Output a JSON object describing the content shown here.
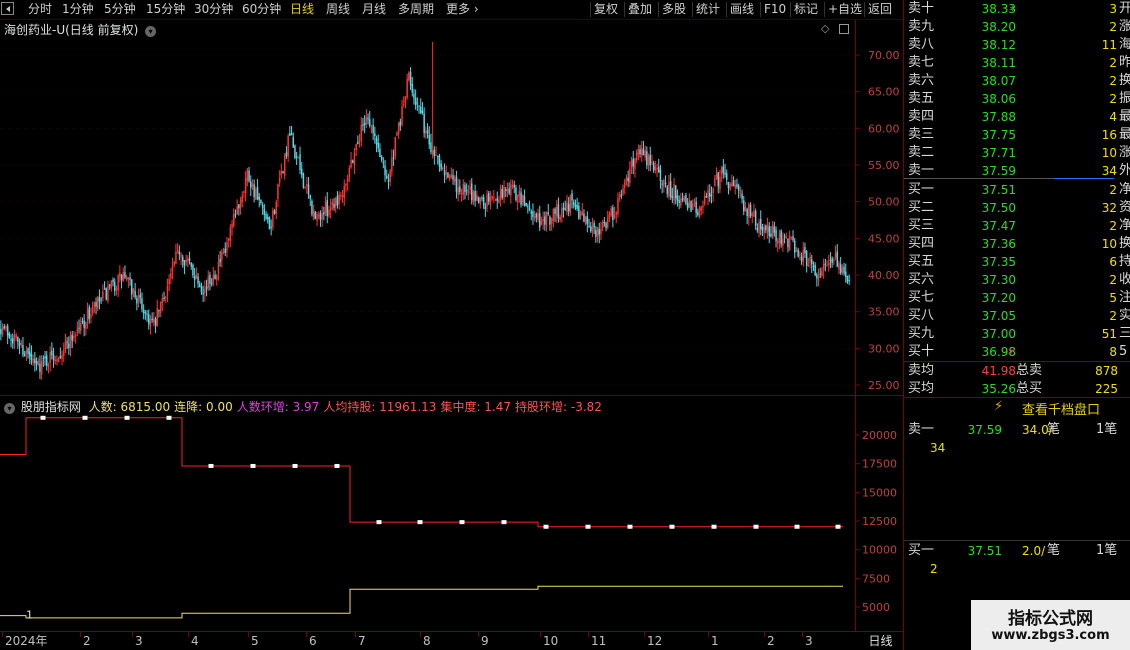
{
  "toolbar": {
    "periods": [
      "分时",
      "1分钟",
      "5分钟",
      "15分钟",
      "30分钟",
      "60分钟",
      "日线",
      "周线",
      "月线",
      "多周期",
      "更多"
    ],
    "active_period": "日线",
    "actions": [
      "复权",
      "叠加",
      "多股",
      "统计",
      "画线",
      "F10",
      "标记",
      "+自选",
      "返回"
    ]
  },
  "colors": {
    "up": "#ff3232",
    "down": "#54d8e6",
    "line_red": "#ff2020",
    "line_yellow": "#f0e060",
    "grid": "#7a0000",
    "axis_text": "#c04040"
  },
  "main_chart": {
    "title": "海创药业-U(日线 前复权)",
    "price_axis": [
      "70.00",
      "65.00",
      "60.00",
      "55.00",
      "50.00",
      "45.00",
      "40.00",
      "35.00",
      "30.00",
      "25.00"
    ],
    "axis_range": [
      25,
      70
    ]
  },
  "indicator": {
    "name": "股朋指标网",
    "values": [
      {
        "label": "人数: 6815.00",
        "color": "#f0e060"
      },
      {
        "label": "连降: 0.00",
        "color": "#f0e060"
      },
      {
        "label": "人数环增: 3.97",
        "color": "#e040e0"
      },
      {
        "label": "人均持股: 11961.13",
        "color": "#ff5050"
      },
      {
        "label": "集中度: 1.47",
        "color": "#ff5050"
      },
      {
        "label": "持股环增: -3.82",
        "color": "#ff5050"
      }
    ],
    "axis": [
      "20000",
      "17500",
      "15000",
      "12500",
      "10000",
      "7500",
      "5000"
    ],
    "axis_range": [
      5000,
      20000
    ],
    "marker_label": "1"
  },
  "date_axis": {
    "ticks": [
      "2024年",
      "2",
      "3",
      "4",
      "5",
      "6",
      "7",
      "8",
      "9",
      "10",
      "11",
      "12",
      "1",
      "2",
      "3"
    ],
    "period_label": "日线"
  },
  "order_book": {
    "sells": [
      {
        "label": "卖十",
        "price": "38.33",
        "vol": "3",
        "side": "开",
        "mark": "up"
      },
      {
        "label": "卖九",
        "price": "38.20",
        "vol": "2",
        "side": "涨"
      },
      {
        "label": "卖八",
        "price": "38.12",
        "vol": "11",
        "side": "海"
      },
      {
        "label": "卖七",
        "price": "38.11",
        "vol": "2",
        "side": "昨"
      },
      {
        "label": "卖六",
        "price": "38.07",
        "vol": "2",
        "side": "换"
      },
      {
        "label": "卖五",
        "price": "38.06",
        "vol": "2",
        "side": "振"
      },
      {
        "label": "卖四",
        "price": "37.88",
        "vol": "4",
        "side": "最"
      },
      {
        "label": "卖三",
        "price": "37.75",
        "vol": "16",
        "side": "最"
      },
      {
        "label": "卖二",
        "price": "37.71",
        "vol": "10",
        "side": "涨"
      },
      {
        "label": "卖一",
        "price": "37.59",
        "vol": "34",
        "side": "外"
      }
    ],
    "buys": [
      {
        "label": "买一",
        "price": "37.51",
        "vol": "2",
        "side": "净"
      },
      {
        "label": "买二",
        "price": "37.50",
        "vol": "32",
        "side": "资"
      },
      {
        "label": "买三",
        "price": "37.47",
        "vol": "2",
        "side": "净"
      },
      {
        "label": "买四",
        "price": "37.36",
        "vol": "10",
        "side": "换"
      },
      {
        "label": "买五",
        "price": "37.35",
        "vol": "6",
        "side": "持"
      },
      {
        "label": "买六",
        "price": "37.30",
        "vol": "2",
        "side": "收"
      },
      {
        "label": "买七",
        "price": "37.20",
        "vol": "5",
        "side": "注"
      },
      {
        "label": "买八",
        "price": "37.05",
        "vol": "2",
        "side": "实"
      },
      {
        "label": "买九",
        "price": "37.00",
        "vol": "51",
        "side": "三"
      },
      {
        "label": "买十",
        "price": "36.98",
        "vol": "8",
        "side": "5",
        "mark": "down"
      }
    ],
    "summary": [
      {
        "label": "卖均",
        "price": "41.98",
        "label2": "总卖",
        "vol": "878",
        "price_color": "#ff4040"
      },
      {
        "label": "买均",
        "price": "35.26",
        "label2": "总买",
        "vol": "225",
        "price_color": "#22e022"
      }
    ]
  },
  "tape": {
    "button": "查看千档盘口",
    "sell1": {
      "label": "卖一",
      "price": "37.59",
      "vol": "34.0/",
      "unit": "笔",
      "count": "1笔",
      "detail": "34"
    },
    "buy1": {
      "label": "买一",
      "price": "37.51",
      "vol": "2.0/",
      "unit": "笔",
      "count": "1笔",
      "detail": "2"
    }
  },
  "watermark": {
    "title": "指标公式网",
    "url": "www.zbgs3.com"
  }
}
